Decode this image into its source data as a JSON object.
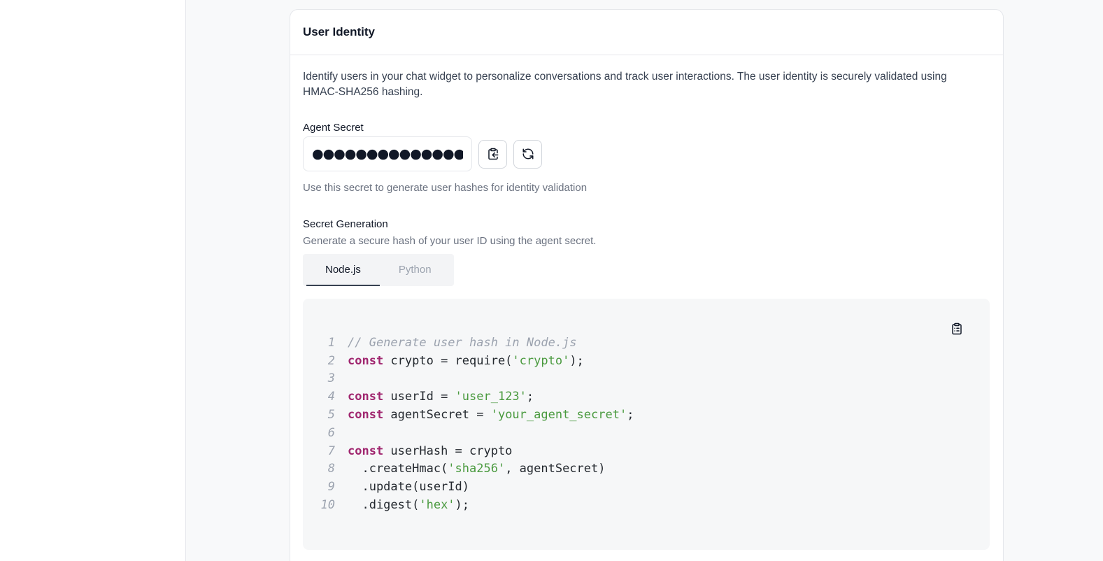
{
  "card": {
    "title": "User Identity",
    "description": "Identify users in your chat widget to personalize conversations and track user interactions. The user identity is securely validated using HMAC-SHA256 hashing."
  },
  "agent_secret": {
    "label": "Agent Secret",
    "value": "●●●●●●●●●●●●●●●",
    "hint": "Use this secret to generate user hashes for identity validation",
    "copy_icon": "clipboard-copy-icon",
    "regenerate_icon": "refresh-icon"
  },
  "secret_generation": {
    "label": "Secret Generation",
    "subtitle": "Generate a secure hash of your user ID using the agent secret.",
    "tabs": [
      {
        "label": "Node.js",
        "active": true
      },
      {
        "label": "Python",
        "active": false
      }
    ]
  },
  "code": {
    "copy_icon": "clipboard-icon",
    "lines": [
      {
        "n": "1",
        "tokens": [
          {
            "t": "cm",
            "v": "// Generate user hash in Node.js"
          }
        ]
      },
      {
        "n": "2",
        "tokens": [
          {
            "t": "kw",
            "v": "const"
          },
          {
            "t": "pl",
            "v": " crypto = require("
          },
          {
            "t": "str",
            "v": "'crypto'"
          },
          {
            "t": "pl",
            "v": ");"
          }
        ]
      },
      {
        "n": "3",
        "tokens": []
      },
      {
        "n": "4",
        "tokens": [
          {
            "t": "kw",
            "v": "const"
          },
          {
            "t": "pl",
            "v": " userId = "
          },
          {
            "t": "str",
            "v": "'user_123'"
          },
          {
            "t": "pl",
            "v": ";"
          }
        ]
      },
      {
        "n": "5",
        "tokens": [
          {
            "t": "kw",
            "v": "const"
          },
          {
            "t": "pl",
            "v": " agentSecret = "
          },
          {
            "t": "str",
            "v": "'your_agent_secret'"
          },
          {
            "t": "pl",
            "v": ";"
          }
        ]
      },
      {
        "n": "6",
        "tokens": []
      },
      {
        "n": "7",
        "tokens": [
          {
            "t": "kw",
            "v": "const"
          },
          {
            "t": "pl",
            "v": " userHash = crypto"
          }
        ]
      },
      {
        "n": "8",
        "tokens": [
          {
            "t": "pl",
            "v": "  .createHmac("
          },
          {
            "t": "str",
            "v": "'sha256'"
          },
          {
            "t": "pl",
            "v": ", agentSecret)"
          }
        ]
      },
      {
        "n": "9",
        "tokens": [
          {
            "t": "pl",
            "v": "  .update(userId)"
          }
        ]
      },
      {
        "n": "10",
        "tokens": [
          {
            "t": "pl",
            "v": "  .digest("
          },
          {
            "t": "str",
            "v": "'hex'"
          },
          {
            "t": "pl",
            "v": ");"
          }
        ]
      }
    ]
  },
  "colors": {
    "keyword": "#a0266f",
    "string": "#4a9a3f",
    "comment": "#9ca3af"
  }
}
